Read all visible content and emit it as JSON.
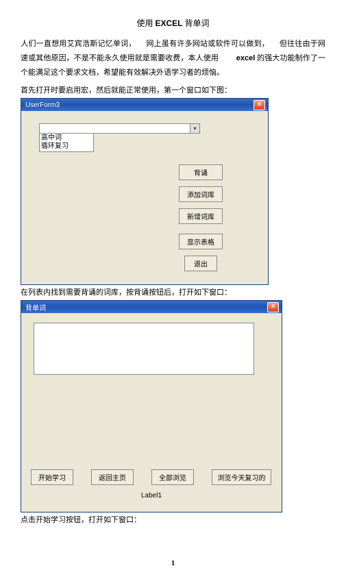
{
  "title_prefix": "使用 ",
  "title_bold": "EXCEL",
  "title_suffix": " 背单词",
  "para1_a": "人们一直想用艾宾浩斯记忆单词，",
  "para1_b": "网上虽有许多网站或软件可以做到，",
  "para1_c": "但往往由于网",
  "para2_a": "速或其他原因，不是不能永久使用就是需要收费，本人使用",
  "para2_kw": "excel",
  "para2_b": " 的强大功能制作了一个能满足这个要求文档，希望能有效解决外语学习者的烦恼。",
  "line1": "首先打开时要启用宏，然后就能正常使用，第一个窗口如下图：",
  "win1": {
    "title": "UserForm3",
    "list_item1": "高中词",
    "list_item2": "循环复习",
    "btn1": "背诵",
    "btn2": "添加词库",
    "btn3": "新增词库",
    "btn4": "显示表格",
    "btn5": "退出"
  },
  "caption1": "在列表内找到需要背诵的词库，按背诵按钮后，打开如下窗口：",
  "win2": {
    "title": "背单词",
    "btn1": "开始学习",
    "btn2": "返回主页",
    "btn3": "全部浏览",
    "btn4": "浏览今天复习的",
    "label": "Label1"
  },
  "caption2": "点击开始学习按钮，打开如下窗口：",
  "pagenum": "1"
}
